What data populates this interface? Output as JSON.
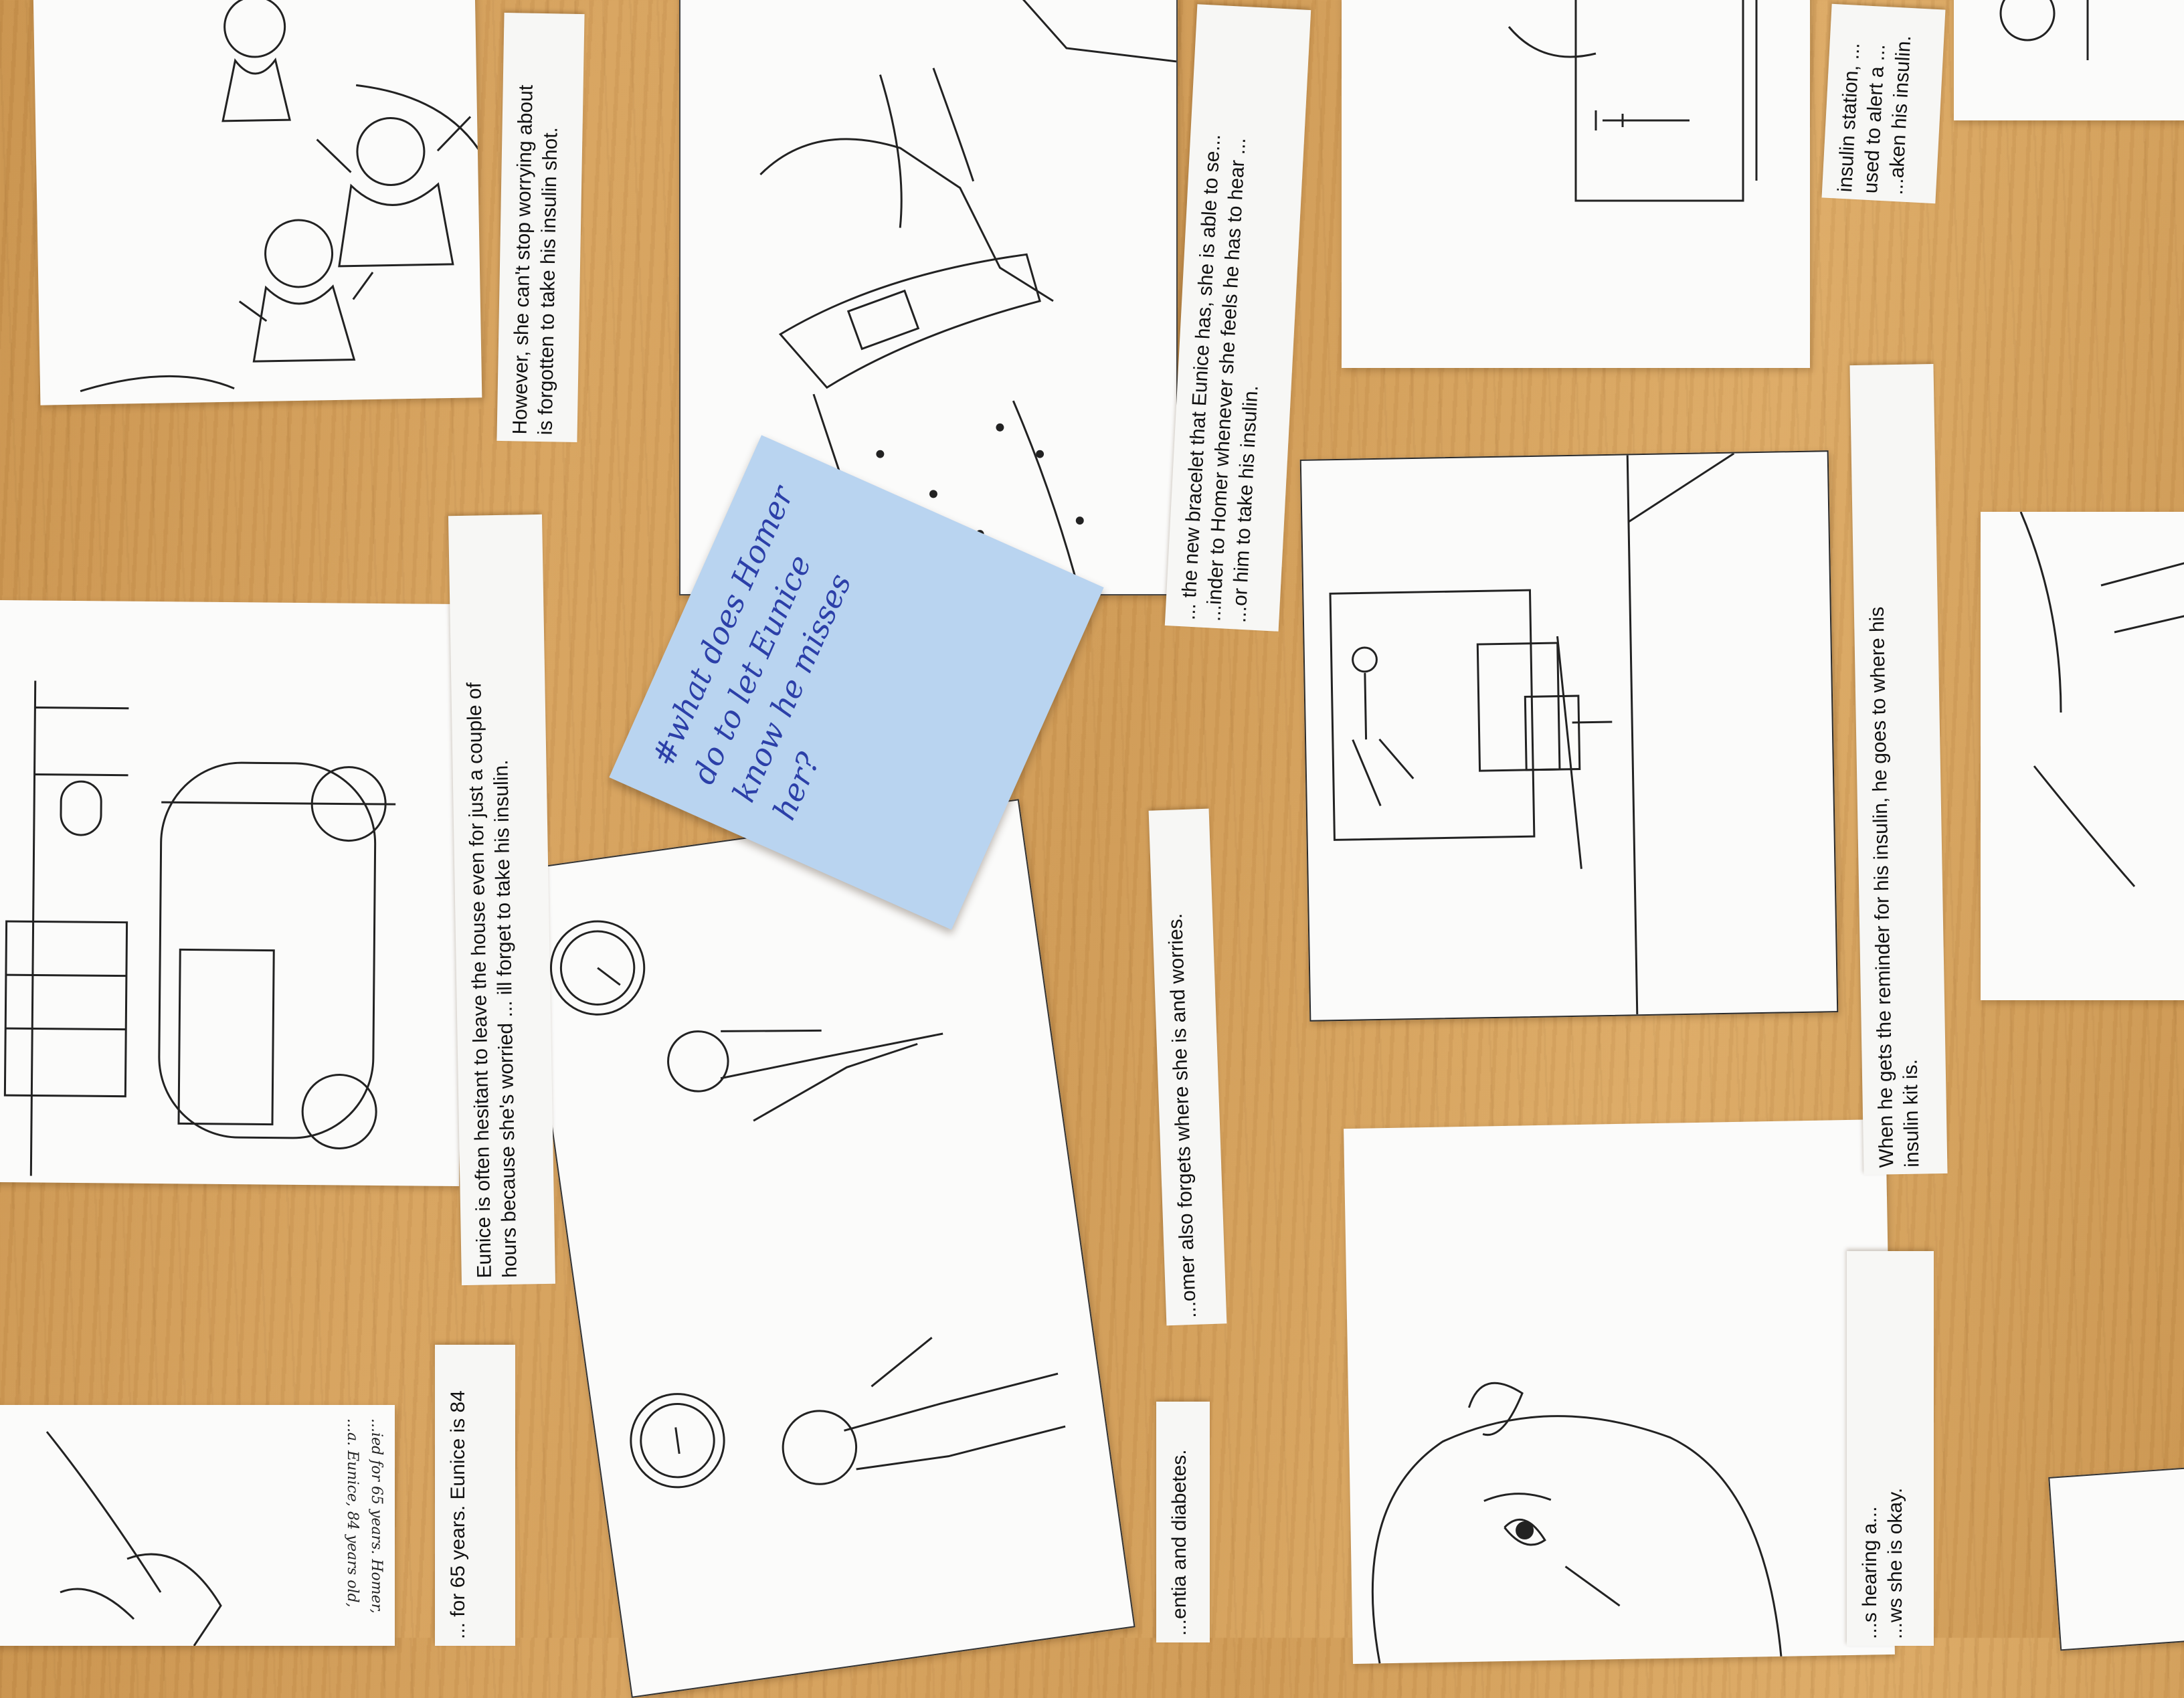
{
  "captions": {
    "c1": "However, she can't stop worrying about",
    "c1b": "is forgotten to take his insulin shot.",
    "c2a": "Eunice is often hesitant to leave the house even for just a couple of",
    "c2b": "hours because she's worried ... ill forget to take his insulin.",
    "c3a": "... the new bracelet that Eunice has, she is able to se...",
    "c3b": "...inder to Homer whenever she feels he has to hear ...",
    "c3c": "...or him to take his insulin.",
    "c4a": "insulin station, ...",
    "c4b": "used to alert a ...",
    "c4c": "...aken his insulin.",
    "c5a": "When he gets the reminder for his insulin, he goes to where his",
    "c5b": "insulin kit is.",
    "c6": "...omer also forgets where she is and worries.",
    "c7": "...entia and diabetes.",
    "c8": "... for 65 years. Eunice is 84",
    "c9a": "...s hearing a...",
    "c9b": "...ws she is okay."
  },
  "handwritten_card": {
    "line1": "...ied for 65 years. Homer,",
    "line2": "...a. Eunice, 84 years old,"
  },
  "sticky_note": {
    "line1": "#what does Homer",
    "line2": "do to let Eunice",
    "line3": "know he misses",
    "line4": "her?"
  },
  "colors": {
    "table": "#d2a05c",
    "paper": "#fbfbfa",
    "sticky": "#b9d4f0",
    "ink_blue": "#2b3fa8"
  }
}
